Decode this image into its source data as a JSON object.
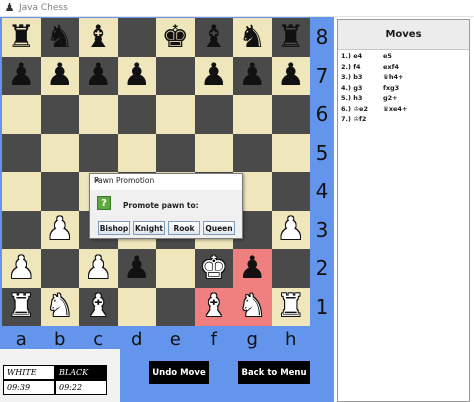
{
  "window": {
    "title": "Java Chess",
    "icon": "pawn-icon"
  },
  "pieces_glyphs": {
    "bk": "♚",
    "bq": "♛",
    "br": "♜",
    "bb": "♝",
    "bn": "♞",
    "bp": "♟",
    "wk": "♚",
    "wq": "♛",
    "wr": "♜",
    "wb": "♝",
    "wn": "♞",
    "wp": "♟"
  },
  "board": [
    [
      "br",
      "bn",
      "bb",
      "",
      "bk",
      "bb",
      "bn",
      "br"
    ],
    [
      "bp",
      "bp",
      "bp",
      "bp",
      "",
      "bp",
      "bp",
      "bp"
    ],
    [
      "",
      "",
      "",
      "",
      "",
      "",
      "",
      ""
    ],
    [
      "",
      "",
      "",
      "",
      "",
      "",
      "",
      ""
    ],
    [
      "",
      "",
      "",
      "",
      "",
      "",
      "",
      ""
    ],
    [
      "",
      "wp",
      "",
      "",
      "",
      "",
      "",
      "wp"
    ],
    [
      "wp",
      "",
      "wp",
      "bp",
      "",
      "wk",
      "bp",
      ""
    ],
    [
      "wr",
      "wn",
      "wb",
      "",
      "",
      "wb",
      "wn",
      "wr"
    ]
  ],
  "highlighted_squares": [
    "g2",
    "f1",
    "g1"
  ],
  "rank_labels": [
    "8",
    "7",
    "6",
    "5",
    "4",
    "3",
    "2",
    "1"
  ],
  "file_labels": [
    "a",
    "b",
    "c",
    "d",
    "e",
    "f",
    "g",
    "h"
  ],
  "colors": {
    "light_square": "#f0e6bc",
    "dark_square": "#4a4a4a",
    "highlight": "#f08080",
    "panel_bg": "#6495ed"
  },
  "timer": {
    "white_label": "WHITE",
    "black_label": "BLACK",
    "white_time": "09:39",
    "black_time": "09:22"
  },
  "buttons": {
    "undo": "Undo Move",
    "menu": "Back to Menu"
  },
  "dialog": {
    "title": "Pawn Promotion",
    "message": "Promote pawn to:",
    "icon": "question-icon",
    "options": [
      "Bishop",
      "Knight",
      "Rook",
      "Queen"
    ]
  },
  "moves": {
    "heading": "Moves",
    "rows": [
      {
        "white": "1.) e4",
        "black": "e5"
      },
      {
        "white": "2.) f4",
        "black": "exf4"
      },
      {
        "white": "3.) b3",
        "black": "♛h4+"
      },
      {
        "white": "4.) g3",
        "black": "fxg3"
      },
      {
        "white": "5.) h3",
        "black": "g2+"
      },
      {
        "white": "6.) ♔e2",
        "black": "♛xe4+"
      },
      {
        "white": "7.) ♔f2",
        "black": ""
      }
    ]
  }
}
